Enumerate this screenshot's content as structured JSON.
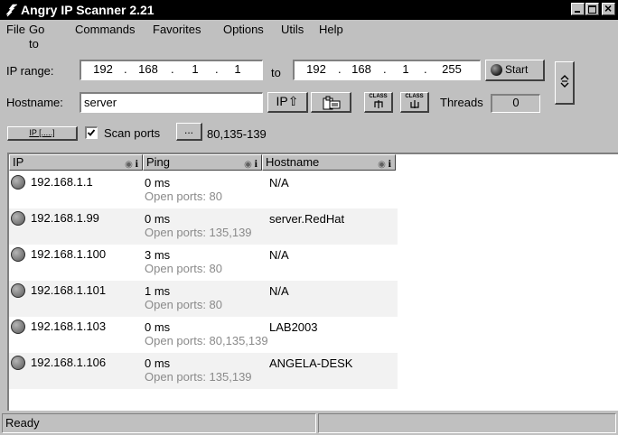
{
  "window": {
    "title": "Angry IP Scanner 2.21"
  },
  "menu": [
    "File",
    "Go to",
    "Commands",
    "Favorites",
    "Options",
    "Utils",
    "Help"
  ],
  "toolbar": {
    "ip_range_label": "IP range:",
    "ip_start": [
      "192",
      "168",
      "1",
      "1"
    ],
    "to_label": "to",
    "ip_end": [
      "192",
      "168",
      "1",
      "255"
    ],
    "start_label": "Start",
    "hostname_label": "Hostname:",
    "hostname_value": "server",
    "ip_up_label": "IP⇧",
    "class_label": "CLASS",
    "threads_label": "Threads",
    "threads_value": "0",
    "range_button_label": "IP [.....]",
    "scan_ports_label": "Scan ports",
    "ports_button_label": "...",
    "ports_value": "80,135-139"
  },
  "table": {
    "columns": [
      "IP",
      "Ping",
      "Hostname"
    ],
    "rows": [
      {
        "ip": "192.168.1.1",
        "ping": "0 ms",
        "ports": "Open ports: 80",
        "hostname": "N/A"
      },
      {
        "ip": "192.168.1.99",
        "ping": "0 ms",
        "ports": "Open ports: 135,139",
        "hostname": "server.RedHat"
      },
      {
        "ip": "192.168.1.100",
        "ping": "3 ms",
        "ports": "Open ports: 80",
        "hostname": "N/A"
      },
      {
        "ip": "192.168.1.101",
        "ping": "1 ms",
        "ports": "Open ports: 80",
        "hostname": "N/A"
      },
      {
        "ip": "192.168.1.103",
        "ping": "0 ms",
        "ports": "Open ports: 80,135,139",
        "hostname": "LAB2003"
      },
      {
        "ip": "192.168.1.106",
        "ping": "0 ms",
        "ports": "Open ports: 135,139",
        "hostname": "ANGELA-DESK"
      }
    ]
  },
  "status": {
    "text": "Ready",
    "secondary": ""
  },
  "icons": {
    "app": "lightning-icon",
    "start": "start-circle-icon",
    "collapse": "collapse-icon",
    "info": "info-icon",
    "row_status": "host-status-icon"
  }
}
